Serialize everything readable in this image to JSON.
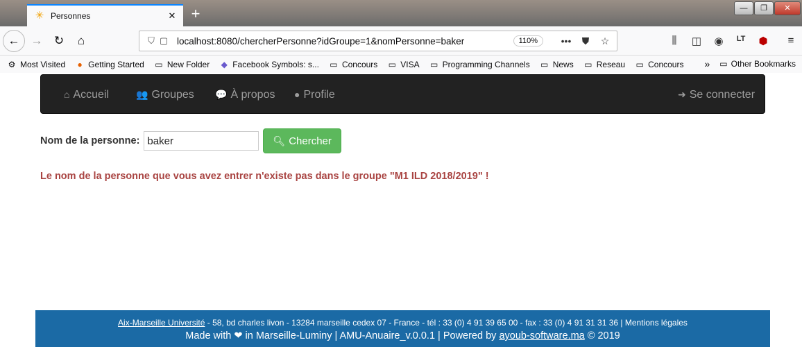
{
  "browser": {
    "tab_title": "Personnes",
    "url": "localhost:8080/chercherPersonne?idGroupe=1&nomPersonne=baker",
    "zoom": "110%",
    "bookmarks": [
      {
        "label": "Most Visited",
        "icon": "gear-icon"
      },
      {
        "label": "Getting Started",
        "icon": "firefox-icon"
      },
      {
        "label": "New Folder",
        "icon": "folder-icon"
      },
      {
        "label": "Facebook Symbols: s...",
        "icon": "puzzle-icon"
      },
      {
        "label": "Concours",
        "icon": "folder-icon"
      },
      {
        "label": "VISA",
        "icon": "folder-icon"
      },
      {
        "label": "Programming Channels",
        "icon": "folder-icon"
      },
      {
        "label": "News",
        "icon": "folder-icon"
      },
      {
        "label": "Reseau",
        "icon": "folder-icon"
      },
      {
        "label": "Concours",
        "icon": "folder-icon"
      }
    ],
    "other_bookmarks": "Other Bookmarks"
  },
  "nav": {
    "home": "Accueil",
    "groups": "Groupes",
    "about": "À propos",
    "profile": "Profile",
    "login": "Se connecter"
  },
  "search": {
    "label": "Nom de la personne:",
    "value": "baker",
    "button": "Chercher"
  },
  "message": "Le nom de la personne que vous avez entrer n'existe pas dans le groupe \"M1 ILD 2018/2019\" !",
  "footer": {
    "university": "Aix-Marseille Université",
    "address": " - 58, bd charles livon - 13284 marseille cedex 07 - France - tél : 33 (0) 4 91 39 65 00 - fax : 33 (0) 4 91 31 31 36 | Mentions légales",
    "made_with": "Made with ❤ in Marseille-Luminy  |  AMU-Anuaire_v.0.0.1  |  Powered by ",
    "powered_by": "ayoub-software.ma",
    "copyright": " © 2019"
  },
  "colors": {
    "navbar": "#222222",
    "success": "#5cb85c",
    "error": "#a94442",
    "footer": "#1b6aa5"
  }
}
